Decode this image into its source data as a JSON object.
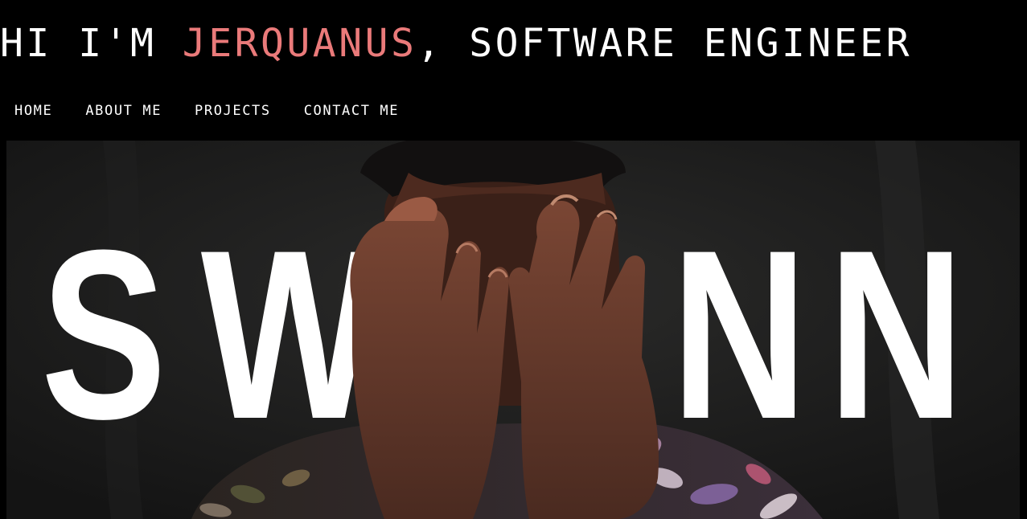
{
  "header": {
    "greeting": "HI I'M ",
    "name": "JERQUANUS",
    "role": ", SOFTWARE ENGINEER",
    "name_color": "#ea7a7a"
  },
  "nav": {
    "items": [
      {
        "label": "HOME"
      },
      {
        "label": "ABOUT ME"
      },
      {
        "label": "PROJECTS"
      },
      {
        "label": "CONTACT ME"
      }
    ]
  },
  "hero": {
    "word_letters": [
      "S",
      "W",
      "N",
      "N"
    ],
    "image_description_icon": "person-covering-face-photo"
  },
  "colors": {
    "background": "#000000",
    "text": "#ffffff",
    "accent": "#ea7a7a"
  }
}
